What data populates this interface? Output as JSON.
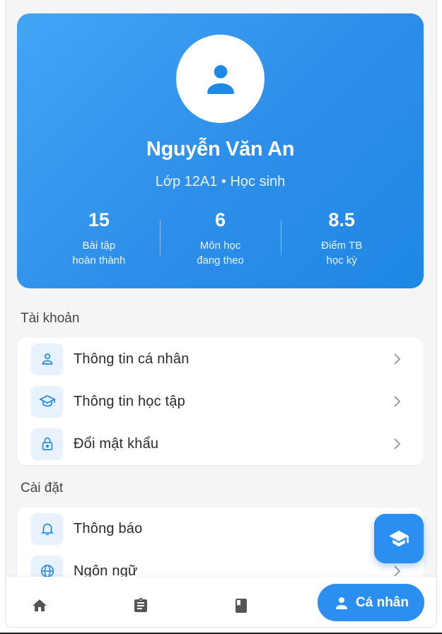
{
  "profile": {
    "name": "Nguyễn Văn An",
    "subline": "Lớp 12A1 • Học sinh",
    "stats": [
      {
        "value": "15",
        "label": "Bài tập\nhoàn thành"
      },
      {
        "value": "6",
        "label": "Môn học\nđang theo"
      },
      {
        "value": "8.5",
        "label": "Điểm TB\nhọc kỳ"
      }
    ]
  },
  "account": {
    "title": "Tài khoản",
    "items": [
      {
        "label": "Thông tin cá nhân",
        "icon": "person-outline-icon"
      },
      {
        "label": "Thông tin học tập",
        "icon": "school-outline-icon"
      },
      {
        "label": "Đổi mật khẩu",
        "icon": "lock-icon"
      }
    ]
  },
  "settings": {
    "title": "Cài đặt",
    "items": [
      {
        "label": "Thông báo",
        "icon": "bell-icon"
      },
      {
        "label": "Ngôn ngữ",
        "icon": "globe-icon"
      }
    ]
  },
  "nav": {
    "items": [
      "home-icon",
      "clipboard-icon",
      "book-icon"
    ],
    "active_label": "Cá nhân"
  },
  "colors": {
    "accent": "#2a8ff0",
    "card_gradient_start": "#42a5f5",
    "card_gradient_end": "#1e88e5",
    "icon_tile": "#e8f2fc"
  }
}
